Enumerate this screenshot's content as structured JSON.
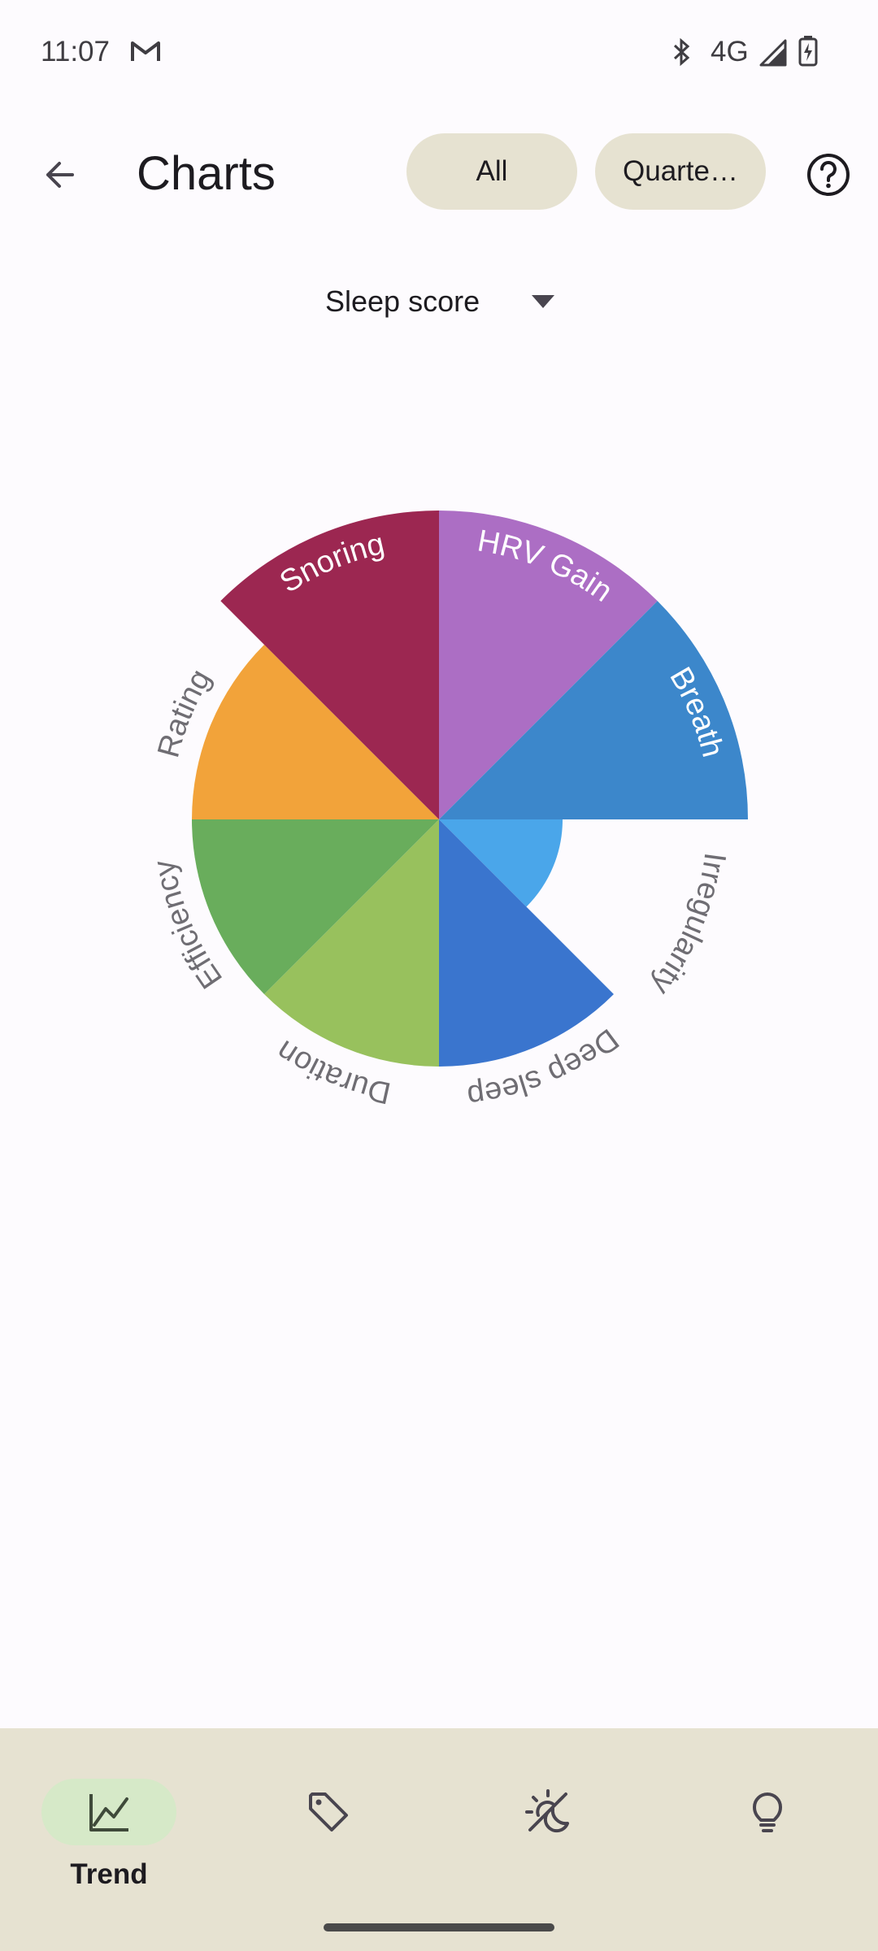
{
  "status_bar": {
    "time": "11:07",
    "network": "4G",
    "icons": [
      "gmail-icon",
      "bluetooth-icon",
      "signal-icon",
      "battery-charging-icon"
    ]
  },
  "app_bar": {
    "title": "Charts",
    "filters": [
      "All",
      "Quarte…"
    ],
    "back_icon": "arrow-back-icon",
    "help_icon": "help-circle-icon"
  },
  "metric_selector": {
    "selected": "Sleep score"
  },
  "chart_data": {
    "type": "pie",
    "subtype": "polar-area",
    "slice_angle_deg": 45,
    "slices": [
      {
        "label": "HRV Gain",
        "value": 1.0,
        "color": "#ac6ec4",
        "label_placement": "inside"
      },
      {
        "label": "Breath",
        "value": 1.0,
        "color": "#3c87cb",
        "label_placement": "inside"
      },
      {
        "label": "Irregularity",
        "value": 0.4,
        "color": "#4aa6ea",
        "label_placement": "outside"
      },
      {
        "label": "Deep sleep",
        "value": 0.8,
        "color": "#3a75ce",
        "label_placement": "outside"
      },
      {
        "label": "Duration",
        "value": 0.8,
        "color": "#98c15d",
        "label_placement": "outside"
      },
      {
        "label": "Efficiency",
        "value": 0.8,
        "color": "#69ad5c",
        "label_placement": "outside"
      },
      {
        "label": "Rating",
        "value": 0.8,
        "color": "#f2a33a",
        "label_placement": "outside"
      },
      {
        "label": "Snoring",
        "value": 1.0,
        "color": "#9c2751",
        "label_placement": "inside"
      }
    ]
  },
  "bottom_nav": {
    "items": [
      {
        "label": "Trend",
        "icon": "trend-chart-icon",
        "active": true
      },
      {
        "label": "",
        "icon": "tag-icon",
        "active": false
      },
      {
        "label": "",
        "icon": "sleep-cycle-icon",
        "active": false
      },
      {
        "label": "",
        "icon": "lightbulb-icon",
        "active": false
      }
    ]
  }
}
